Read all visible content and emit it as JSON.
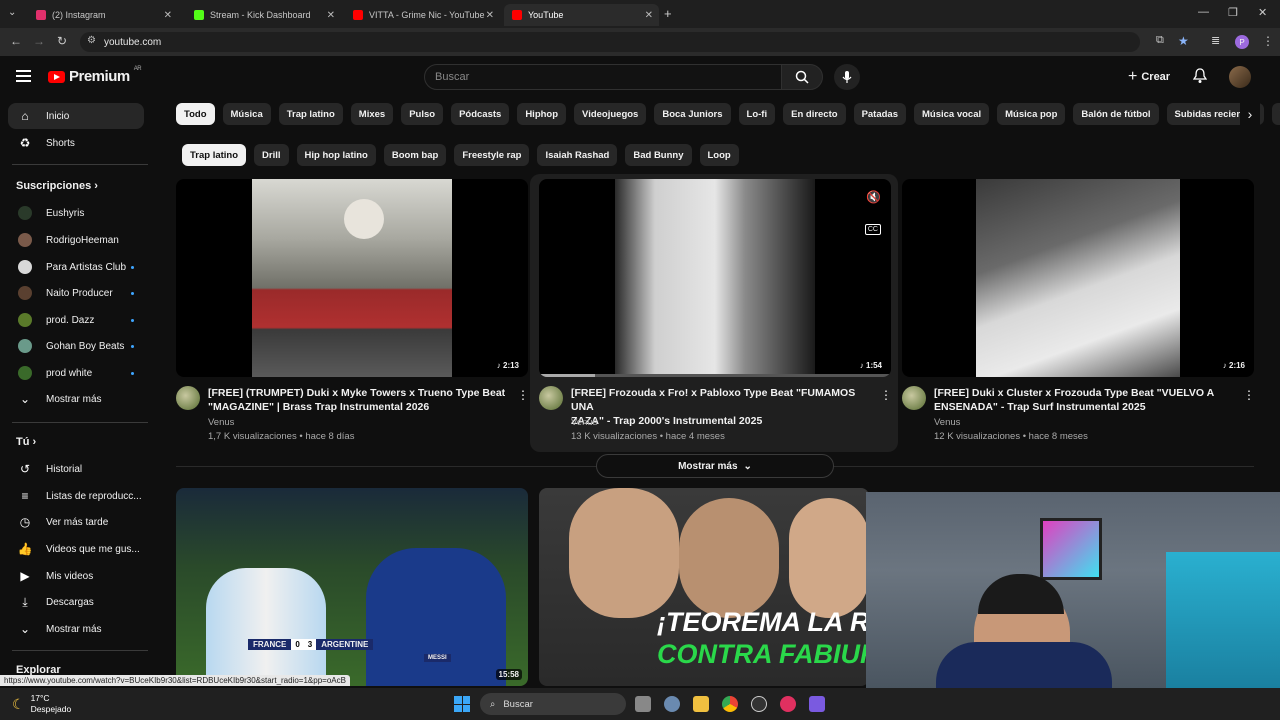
{
  "browser": {
    "tabs": [
      {
        "label": "(2) Instagram",
        "color": "#e1306c"
      },
      {
        "label": "Stream - Kick Dashboard",
        "color": "#53fc18"
      },
      {
        "label": "VITTA - Grime Nic - YouTube",
        "color": "#ff0000"
      },
      {
        "label": "YouTube",
        "color": "#ff0000"
      }
    ],
    "url": "youtube.com",
    "profile_initial": "P",
    "status_url": "https://www.youtube.com/watch?v=BUceKIb9r30&list=RDBUceKIb9r30&start_radio=1&pp=oAcB"
  },
  "header": {
    "logo": "Premium",
    "logo_region": "AR",
    "search_placeholder": "Buscar",
    "create_label": "Crear"
  },
  "sidebar": {
    "main": [
      {
        "label": "Inicio",
        "icon": "home-icon"
      },
      {
        "label": "Shorts",
        "icon": "shorts-icon"
      }
    ],
    "subs_title": "Suscripciones",
    "subs": [
      {
        "label": "Eushyris",
        "color": "#2a3a2a",
        "live": false
      },
      {
        "label": "RodrigoHeeman",
        "color": "#7a5a4a",
        "live": false
      },
      {
        "label": "Para Artistas Club",
        "color": "#d8d8d8",
        "live": true
      },
      {
        "label": "Naito Producer",
        "color": "#5a4030",
        "live": true
      },
      {
        "label": "prod. Dazz",
        "color": "#5a7a2a",
        "live": true
      },
      {
        "label": "Gohan Boy Beats",
        "color": "#6a9a8a",
        "live": true
      },
      {
        "label": "prod white",
        "color": "#3a6a2a",
        "live": true
      }
    ],
    "more_label": "Mostrar más",
    "you_title": "Tú",
    "you": [
      {
        "label": "Historial",
        "icon": "history-icon"
      },
      {
        "label": "Listas de reproducc...",
        "icon": "playlist-icon"
      },
      {
        "label": "Ver más tarde",
        "icon": "watch-later-icon"
      },
      {
        "label": "Videos que me gus...",
        "icon": "like-icon"
      },
      {
        "label": "Mis videos",
        "icon": "my-videos-icon"
      },
      {
        "label": "Descargas",
        "icon": "download-icon"
      },
      {
        "label": "Mostrar más",
        "icon": "chevron-down-icon"
      }
    ],
    "explore_title": "Explorar"
  },
  "chips_primary": [
    "Todo",
    "Música",
    "Trap latino",
    "Mixes",
    "Pulso",
    "Pódcasts",
    "Hiphop",
    "Videojuegos",
    "Boca Juniors",
    "Lo-fi",
    "En directo",
    "Patadas",
    "Música vocal",
    "Música pop",
    "Balón de fútbol",
    "Subidas recientes",
    "Vist"
  ],
  "chips_secondary": [
    "Trap latino",
    "Drill",
    "Hip hop latino",
    "Boom bap",
    "Freestyle rap",
    "Isaiah Rashad",
    "Bad Bunny",
    "Loop"
  ],
  "videos": [
    {
      "title1": "[FREE] (TRUMPET) Duki x Myke Towers x Trueno Type Beat",
      "title2": "\"MAGAZINE\" | Brass Trap Instrumental 2026",
      "channel": "Venus",
      "meta": "1,7 K visualizaciones • hace 8 días",
      "duration": "♪ 2:13"
    },
    {
      "title1": "[FREE] Frozouda x Fro! x Pabloxo Type Beat \"FUMAMOS UNA",
      "title2": "ZAZA\" - Trap 2000's Instrumental 2025",
      "channel": "Venus",
      "meta": "13 K visualizaciones • hace 4 meses",
      "duration": "♪ 1:54"
    },
    {
      "title1": "[FREE] Duki x Cluster x Frozouda Type Beat \"VUELVO A",
      "title2": "ENSENADA\" - Trap Surf Instrumental 2025",
      "channel": "Venus",
      "meta": "12 K visualizaciones • hace 8 meses",
      "duration": "♪ 2:16"
    }
  ],
  "show_more_label": "Mostrar más",
  "row2": {
    "score_home": "FRANCE",
    "score_home_goals": "0",
    "score_away_goals": "3",
    "score_away": "ARGENTINE",
    "score_player": "MESSI",
    "duration": "15:58",
    "thumb2_line1": "¡TEOREMA LA ROMP",
    "thumb2_line2": "CONTRA FABIUKI"
  },
  "taskbar": {
    "temp": "17°C",
    "weather": "Despejado",
    "search": "Buscar"
  }
}
